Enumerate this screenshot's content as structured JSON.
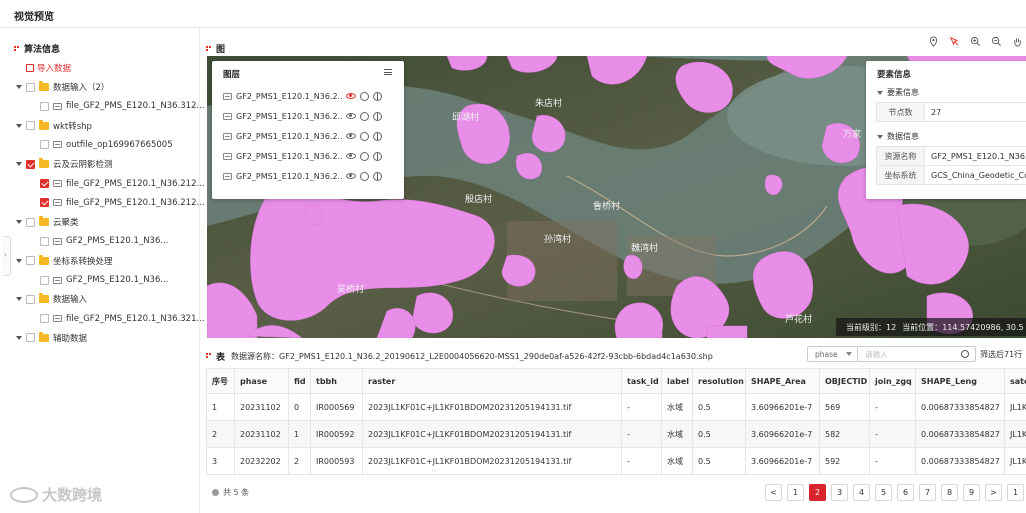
{
  "header": {
    "title": "视觉预览"
  },
  "left": {
    "section_title": "算法信息",
    "import_label": "导入数据",
    "tree": [
      {
        "type": "folder",
        "label": "数据输入（2）",
        "checked": false
      },
      {
        "type": "file",
        "label": "file_GF2_PMS_E120.1_N36.312...",
        "checked": false
      },
      {
        "type": "folder",
        "label": "wkt转shp",
        "checked": false
      },
      {
        "type": "file",
        "label": "outfile_op169967665005",
        "checked": false
      },
      {
        "type": "folder",
        "label": "云及云阴影检测",
        "checked": true
      },
      {
        "type": "file",
        "label": "file_GF2_PMS_E120.1_N36.212...",
        "checked": true
      },
      {
        "type": "file",
        "label": "file_GF2_PMS_E120.1_N36.212...",
        "checked": true
      },
      {
        "type": "folder",
        "label": "云聚类",
        "checked": false
      },
      {
        "type": "file",
        "label": "GF2_PMS_E120.1_N36...",
        "checked": false
      },
      {
        "type": "folder",
        "label": "坐标系转换处理",
        "checked": false
      },
      {
        "type": "file",
        "label": "GF2_PMS_E120.1_N36...",
        "checked": false
      },
      {
        "type": "folder",
        "label": "数据输入",
        "checked": false
      },
      {
        "type": "file",
        "label": "file_GF2_PMS_E120.1_N36.321...",
        "checked": false
      },
      {
        "type": "folder",
        "label": "辅助数据",
        "checked": false
      }
    ]
  },
  "map": {
    "section_title": "图",
    "tools": [
      "location-pin-icon",
      "pointer-select-icon",
      "zoom-in-icon",
      "zoom-out-icon",
      "hand-pan-icon"
    ],
    "places": [
      "朱店村",
      "邱湖村",
      "殷店村",
      "鲁桥村",
      "孙湾村",
      "魏湾村",
      "吴桥村",
      "芦花村",
      "万家"
    ],
    "layers": {
      "title": "图层",
      "items": [
        {
          "name": "GF2_PMS1_E120.1_N36.2...",
          "visible": true
        },
        {
          "name": "GF2_PMS1_E120.1_N36.2...",
          "visible": false
        },
        {
          "name": "GF2_PMS1_E120.1_N36.2...",
          "visible": false
        },
        {
          "name": "GF2_PMS1_E120.1_N36.2...",
          "visible": false
        },
        {
          "name": "GF2_PMS1_E120.1_N36.2...",
          "visible": false
        }
      ]
    },
    "feature_info": {
      "title": "要素信息",
      "element_section": "要素信息",
      "node_count_label": "节点数",
      "node_count_value": "27",
      "data_section": "数据信息",
      "resource_label": "资源名称",
      "resource_value": "GF2_PMS1_E120.1_N36.",
      "crs_label": "坐标系统",
      "crs_value": "GCS_China_Geodetic_Co"
    },
    "status": {
      "level_label": "当前级别：",
      "level_value": "12",
      "position_label": "当前位置：",
      "position_value": "114.57420986, 30.5"
    }
  },
  "table": {
    "section_title": "表",
    "dataset_label": "数据源名称：",
    "dataset_name": "GF2_PMS1_E120.1_N36.2_20190612_L2E0004056620-MSS1_290de0af-a526-42f2-93cbb-6bdad4c1a630.shp",
    "filter_field": "phase",
    "search_placeholder": "请输入",
    "filter_count": "筛选后71行",
    "columns": [
      "序号",
      "phase",
      "fid",
      "tbbh",
      "raster",
      "task_id",
      "label",
      "resolution",
      "SHAPE_Area",
      "OBJECTID",
      "join_zgq",
      "SHAPE_Leng",
      "sate"
    ],
    "rows": [
      [
        "1",
        "20231102",
        "0",
        "IR000569",
        "2023JL1KF01C+JL1KF01BDOM20231205194131.tif",
        "-",
        "水域",
        "0.5",
        "3.60966201e-7",
        "569",
        "-",
        "0.00687333854827",
        "JL1K"
      ],
      [
        "2",
        "20231102",
        "1",
        "IR000592",
        "2023JL1KF01C+JL1KF01BDOM20231205194131.tif",
        "-",
        "水域",
        "0.5",
        "3.60966201e-7",
        "582",
        "-",
        "0.00687333854827",
        "JL1K"
      ],
      [
        "3",
        "20232202",
        "2",
        "IR000593",
        "2023JL1KF01C+JL1KF01BDOM20231205194131.tif",
        "-",
        "水域",
        "0.5",
        "3.60966201e-7",
        "592",
        "-",
        "0.00687333854827",
        "JL1K"
      ]
    ],
    "total_label": "共 5 条",
    "pages": [
      "<",
      "1",
      "2",
      "3",
      "4",
      "5",
      "6",
      "7",
      "8",
      "9",
      ">",
      "1"
    ],
    "active_page": "2"
  },
  "watermark": "大数跨境",
  "colors": {
    "accent": "#e0302d",
    "cloud_mask": "#e88ee8",
    "folder": "#f5b923"
  }
}
